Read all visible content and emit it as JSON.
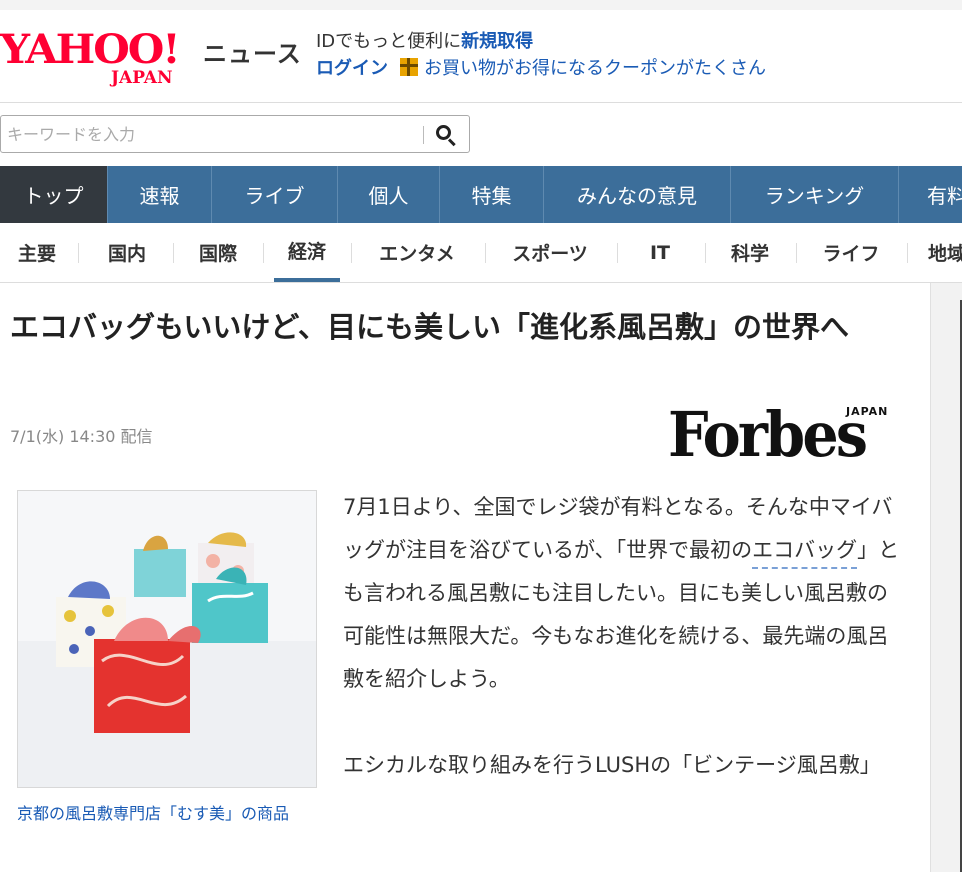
{
  "header": {
    "logo_main": "YAHOO!",
    "logo_sub": "JAPAN",
    "news_label": "ニュース",
    "id_prefix": "IDでもっと便利に",
    "id_link": "新規取得",
    "login": "ログイン",
    "coupon_text": "お買い物がお得になるクーポンがたくさん"
  },
  "search": {
    "placeholder": "キーワードを入力",
    "value": ""
  },
  "main_nav": [
    {
      "label": "トップ",
      "active": true
    },
    {
      "label": "速報"
    },
    {
      "label": "ライブ"
    },
    {
      "label": "個人"
    },
    {
      "label": "特集"
    },
    {
      "label": "みんなの意見"
    },
    {
      "label": "ランキング"
    },
    {
      "label": "有料"
    }
  ],
  "sub_nav": [
    {
      "label": "主要"
    },
    {
      "label": "国内"
    },
    {
      "label": "国際"
    },
    {
      "label": "経済",
      "active": true
    },
    {
      "label": "エンタメ"
    },
    {
      "label": "スポーツ"
    },
    {
      "label": "IT"
    },
    {
      "label": "科学"
    },
    {
      "label": "ライフ"
    },
    {
      "label": "地域"
    }
  ],
  "article": {
    "title": "エコバッグもいいけど、目にも美しい「進化系風呂敷」の世界へ",
    "date": "7/1(水) 14:30 配信",
    "source_logo": "Forbes",
    "source_logo_sub": "JAPAN",
    "image_caption": "京都の風呂敷専門店「むす美」の商品",
    "para1_a": "7月1日より、全国でレジ袋が有料となる。そんな中マイバッグが注目を浴びているが、「世界で最初の",
    "para1_link": "エコバッグ",
    "para1_b": "」とも言われる風呂敷にも注目したい。目にも美しい風呂敷の可能性は無限大だ。今もなお進化を続ける、最先端の風呂敷を紹介しよう。",
    "para2": "エシカルな取り組みを行うLUSHの「ビンテージ風呂敷」"
  },
  "colors": {
    "yahoo_red": "#ff0033",
    "nav_blue": "#3c6e9a",
    "nav_active": "#33393f",
    "link_blue": "#1a5bb5"
  }
}
